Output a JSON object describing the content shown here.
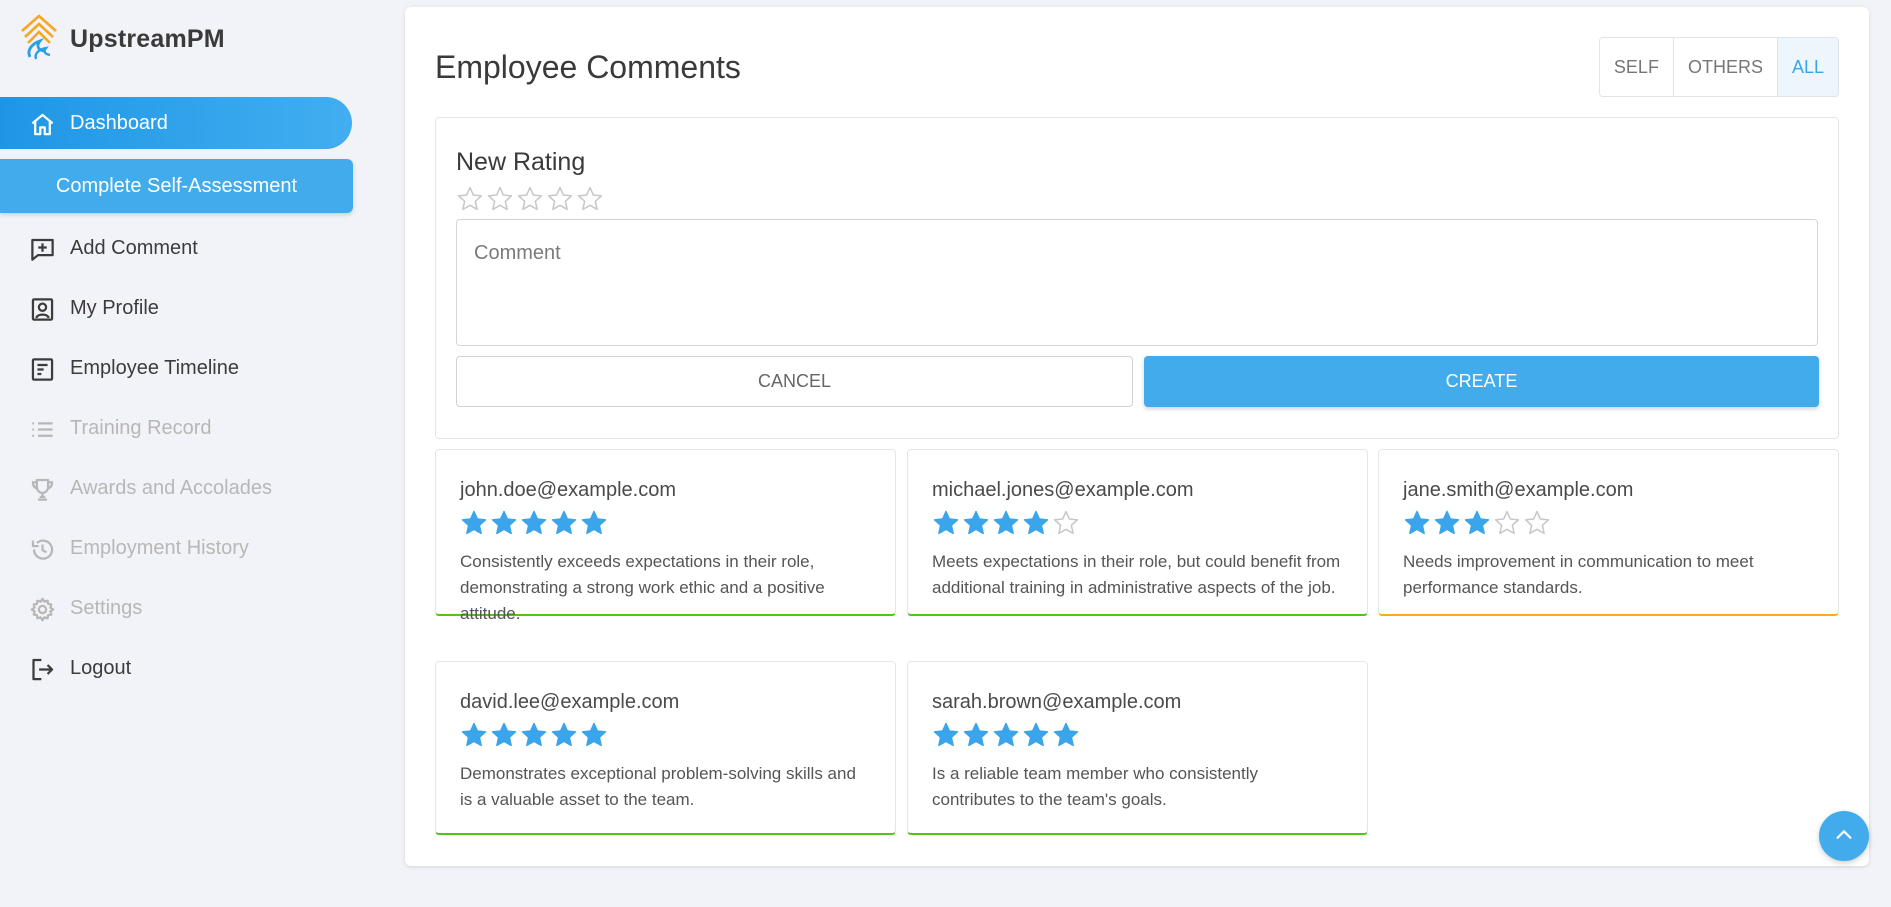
{
  "app": {
    "name": "UpstreamPM"
  },
  "sidebar": {
    "items": [
      {
        "id": "dashboard",
        "label": "Dashboard",
        "icon": "home-icon",
        "state": "active"
      },
      {
        "id": "add-comment",
        "label": "Add Comment",
        "icon": "add-comment-icon",
        "state": "normal"
      },
      {
        "id": "my-profile",
        "label": "My Profile",
        "icon": "profile-icon",
        "state": "normal"
      },
      {
        "id": "employee-timeline",
        "label": "Employee Timeline",
        "icon": "timeline-icon",
        "state": "normal"
      },
      {
        "id": "training-record",
        "label": "Training Record",
        "icon": "list-icon",
        "state": "disabled"
      },
      {
        "id": "awards",
        "label": "Awards and Accolades",
        "icon": "trophy-icon",
        "state": "disabled"
      },
      {
        "id": "employment-history",
        "label": "Employment History",
        "icon": "history-icon",
        "state": "disabled"
      },
      {
        "id": "settings",
        "label": "Settings",
        "icon": "gear-icon",
        "state": "disabled"
      },
      {
        "id": "logout",
        "label": "Logout",
        "icon": "logout-icon",
        "state": "normal"
      }
    ],
    "cta_label": "Complete Self-Assessment"
  },
  "main": {
    "title": "Employee Comments",
    "filters": [
      {
        "label": "SELF",
        "active": false
      },
      {
        "label": "OTHERS",
        "active": false
      },
      {
        "label": "ALL",
        "active": true
      }
    ],
    "new_rating": {
      "title": "New Rating",
      "rating": 0,
      "max_rating": 5,
      "comment_placeholder": "Comment",
      "comment_value": "",
      "cancel_label": "CANCEL",
      "create_label": "CREATE"
    },
    "comments": [
      {
        "email": "john.doe@example.com",
        "rating": 5,
        "text": "Consistently exceeds expectations in their role, demonstrating a strong work ethic and a positive attitude.",
        "accent": "#52c41a"
      },
      {
        "email": "michael.jones@example.com",
        "rating": 4,
        "text": "Meets expectations in their role, but could benefit from additional training in administrative aspects of the job.",
        "accent": "#52c41a"
      },
      {
        "email": "jane.smith@example.com",
        "rating": 3,
        "text": "Needs improvement in communication to meet performance standards.",
        "accent": "#faad14"
      },
      {
        "email": "david.lee@example.com",
        "rating": 5,
        "text": "Demonstrates exceptional problem-solving skills and is a valuable asset to the team.",
        "accent": "#52c41a"
      },
      {
        "email": "sarah.brown@example.com",
        "rating": 5,
        "text": "Is a reliable team member who consistently contributes to the team's goals.",
        "accent": "#52c41a"
      }
    ]
  },
  "colors": {
    "primary": "#42abeb",
    "star_filled": "#3aa5ea",
    "star_empty": "#c7c7c7",
    "success": "#52c41a",
    "warning": "#faad14"
  },
  "scroll_top": {
    "icon": "chevron-up-icon"
  }
}
